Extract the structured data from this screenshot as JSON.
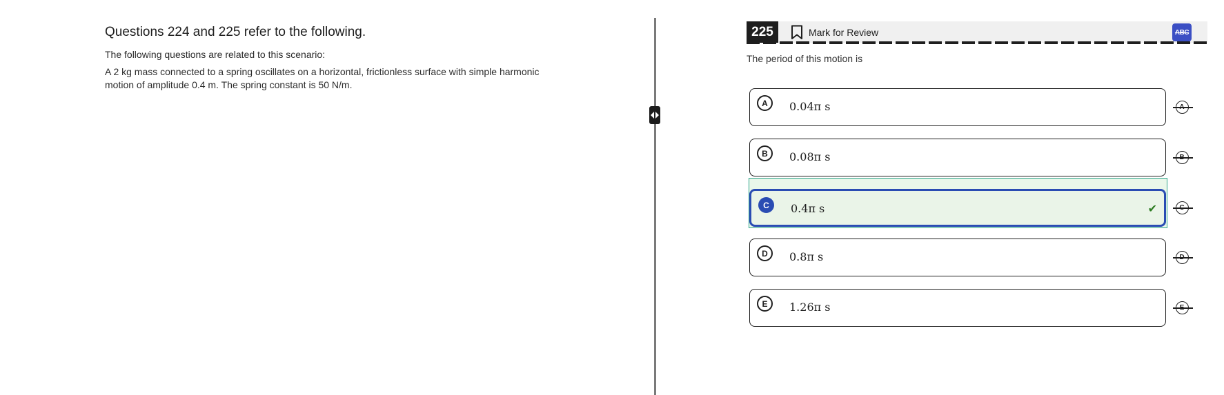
{
  "passage": {
    "title": "Questions 224 and 225 refer to the following.",
    "intro": "The following questions are related to this scenario:",
    "body": "A 2 kg mass connected to a spring oscillates on a horizontal, frictionless surface with simple harmonic motion of amplitude 0.4 m. The spring constant is 50 N/m."
  },
  "question": {
    "number": "225",
    "mark_for_review_label": "Mark for Review",
    "abc_label": "ABC",
    "prompt": "The period of this motion is",
    "choices": [
      {
        "letter": "A",
        "text": "0.04π s"
      },
      {
        "letter": "B",
        "text": "0.08π s"
      },
      {
        "letter": "C",
        "text": "0.4π s",
        "selected": true
      },
      {
        "letter": "D",
        "text": "0.8π s"
      },
      {
        "letter": "E",
        "text": "1.26π s"
      }
    ],
    "check_mark": "✔"
  },
  "colors": {
    "accent": "#2a4cb3",
    "abc_button": "#3b4fc4",
    "selected_fill": "#eaf4e8",
    "selected_outline": "#30a58b",
    "check": "#2c7b21"
  },
  "icons": {
    "bookmark": "bookmark-icon",
    "divider_handle": "resize-handle-icon",
    "check": "check-icon",
    "strikethrough": "strikethrough-icon"
  }
}
